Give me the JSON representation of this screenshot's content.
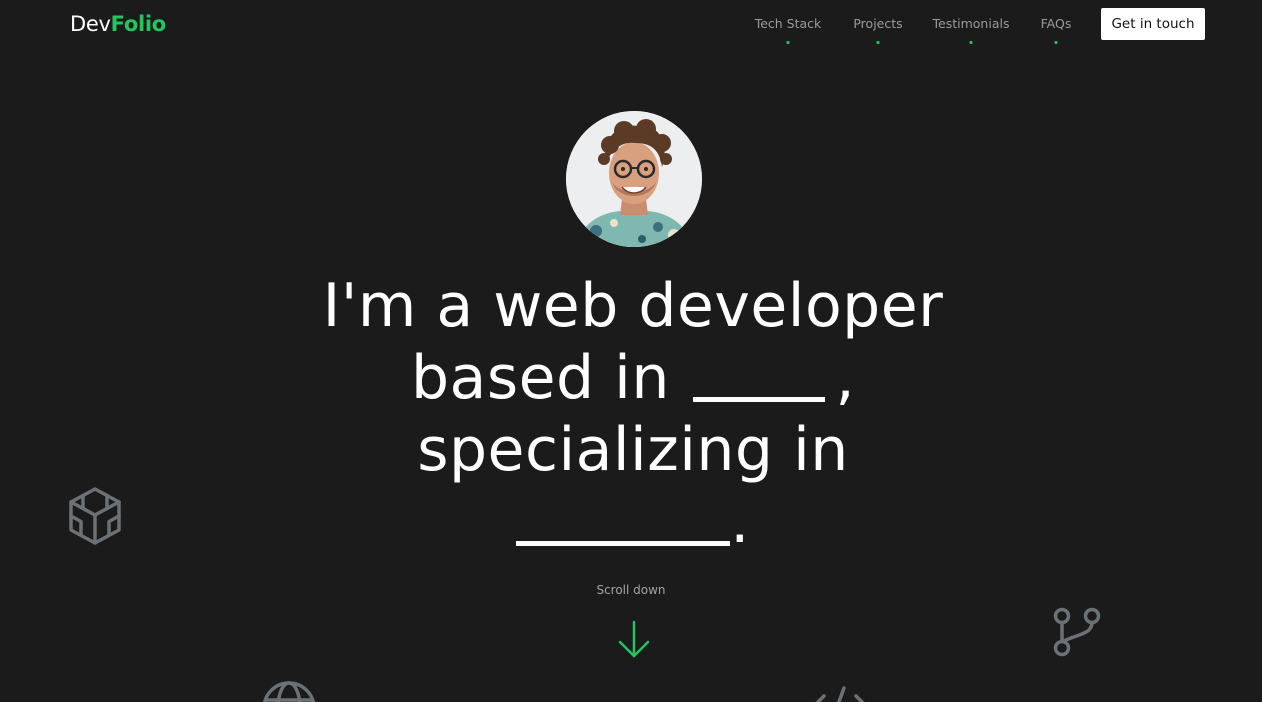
{
  "brand": {
    "part1": "Dev",
    "part2": "Folio",
    "accent": "#22c55e"
  },
  "nav": {
    "items": [
      {
        "label": "Tech Stack"
      },
      {
        "label": "Projects"
      },
      {
        "label": "Testimonials"
      },
      {
        "label": "FAQs"
      }
    ],
    "cta_label": "Get in touch"
  },
  "avatar": {
    "alt": "Developer portrait"
  },
  "hero": {
    "line1": "I'm a web developer",
    "line2_prefix": "based in",
    "line2_suffix": ",",
    "line3": "specializing in",
    "line4_suffix": "."
  },
  "scroll": {
    "label": "Scroll down",
    "icon": "arrow-down-icon"
  },
  "decorations": [
    "codesandbox-icon",
    "git-branch-icon",
    "globe-icon",
    "code-icon"
  ],
  "colors": {
    "background": "#1b1b1b",
    "accent": "#22c55e",
    "icon_gray": "#6b7177"
  }
}
